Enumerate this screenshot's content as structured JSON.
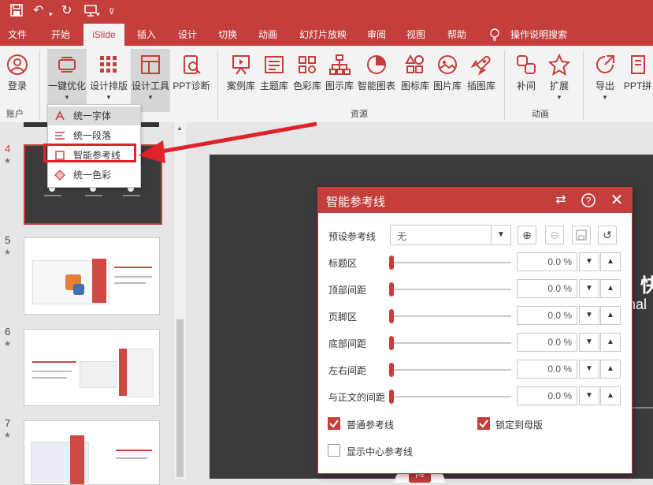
{
  "ribbon_tabs": [
    "文件",
    "开始",
    "iSlide",
    "插入",
    "设计",
    "切换",
    "动画",
    "幻灯片放映",
    "审阅",
    "视图",
    "帮助",
    "操作说明搜索"
  ],
  "ribbon": {
    "buttons": {
      "login": "登录",
      "optimize": "一键优化",
      "layout": "设计排版",
      "tools": "设计工具",
      "diagnose": "PPT诊断",
      "cases": "案例库",
      "themes": "主题库",
      "colors": "色彩库",
      "diagrams": "图示库",
      "smartchart": "智能图表",
      "icons": "图标库",
      "pictures": "图片库",
      "illustrations": "插图库",
      "tween": "补间",
      "extend": "扩展",
      "export": "导出",
      "ppt_split": "PPT拼"
    },
    "groups": {
      "account": "账户",
      "resources": "资源",
      "animation": "动画"
    }
  },
  "dropdown": {
    "items": [
      "统一字体",
      "统一段落",
      "智能参考线",
      "统一色彩"
    ]
  },
  "slides": {
    "numbers": [
      "4",
      "5",
      "6",
      "7"
    ],
    "star": "★"
  },
  "slide_partial": {
    "text1": "快",
    "text2": "nal"
  },
  "dialog": {
    "title": "智能参考线",
    "preset_label": "预设参考线",
    "preset_value": "无",
    "rows": [
      {
        "label": "标题区",
        "value": "0.0 %"
      },
      {
        "label": "顶部间距",
        "value": "0.0 %"
      },
      {
        "label": "页脚区",
        "value": "0.0 %"
      },
      {
        "label": "底部间距",
        "value": "0.0 %"
      },
      {
        "label": "左右间距",
        "value": "0.0 %"
      },
      {
        "label": "与正文的间距",
        "value": "0.0 %"
      }
    ],
    "checkboxes": {
      "normal": "普通参考线",
      "lock": "锁定到母版",
      "center": "显示中心参考线"
    }
  },
  "colors": {
    "accent": "#c43e3c",
    "highlight": "#e0232a"
  }
}
